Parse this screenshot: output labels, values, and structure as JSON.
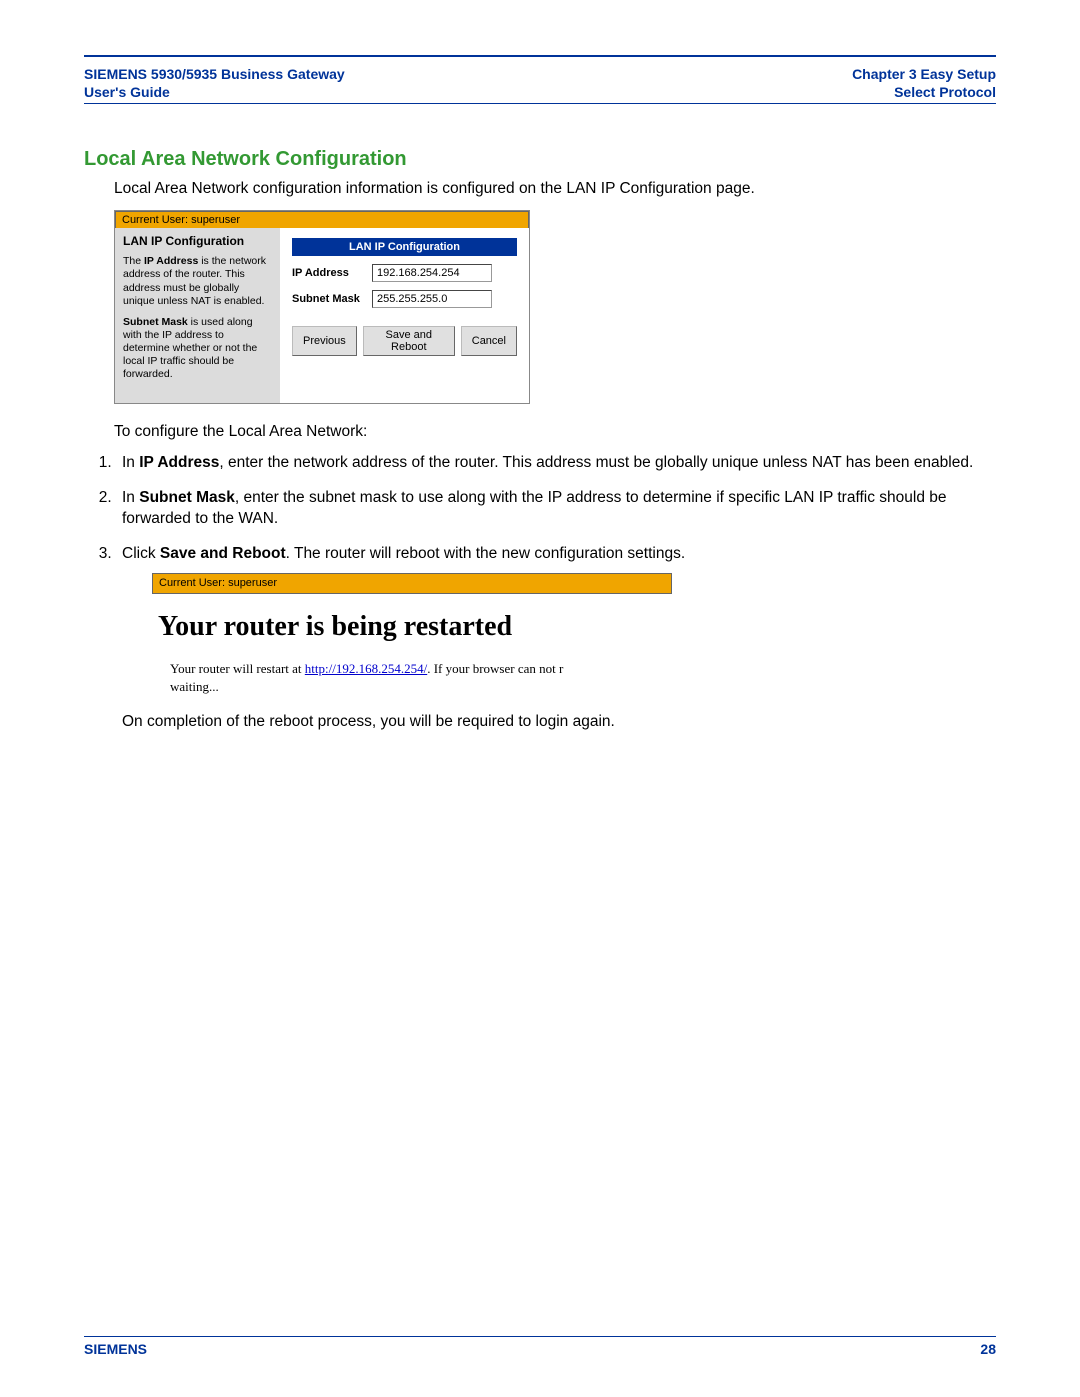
{
  "header": {
    "left_line1": "SIEMENS 5930/5935 Business Gateway",
    "left_line2": "User's Guide",
    "right_line1": "Chapter 3  Easy Setup",
    "right_line2": "Select Protocol"
  },
  "section_title": "Local Area Network Configuration",
  "intro_text": "Local Area Network configuration information is configured on the LAN IP Configuration page.",
  "shot1": {
    "current_user": "Current User: superuser",
    "panel_title": "LAN IP Configuration",
    "help_ip_prefix": "The ",
    "help_ip_bold": "IP Address",
    "help_ip_rest": " is the network address of the router. This address must be globally unique unless NAT is enabled.",
    "help_mask_bold": "Subnet Mask",
    "help_mask_rest": " is used along with the IP address to determine whether or not the local IP traffic should be forwarded.",
    "config_header": "LAN IP Configuration",
    "label_ip": "IP Address",
    "value_ip": "192.168.254.254",
    "label_mask": "Subnet Mask",
    "value_mask": "255.255.255.0",
    "btn_prev": "Previous",
    "btn_save": "Save and Reboot",
    "btn_cancel": "Cancel"
  },
  "configure_intro": "To configure the Local Area Network:",
  "steps": {
    "s1_pre": "In ",
    "s1_bold": "IP Address",
    "s1_post": ", enter the network address of the router. This address must be globally unique unless NAT has been enabled.",
    "s2_pre": "In ",
    "s2_bold": "Subnet Mask",
    "s2_post": ", enter the subnet mask to use along with the IP address to determine if specific LAN IP traffic should be forwarded to the WAN.",
    "s3_pre": "Click ",
    "s3_bold": "Save and Reboot",
    "s3_post": ". The router will reboot with the new configuration settings."
  },
  "shot2": {
    "current_user": "Current User: superuser",
    "heading": "Your router is being restarted",
    "msg_pre": "Your router will restart at ",
    "msg_link": "http://192.168.254.254/",
    "msg_post": ". If your browser can not r",
    "msg_line2": "waiting..."
  },
  "after_shot2": "On completion of the reboot process, you will be required to login again.",
  "footer": {
    "brand": "SIEMENS",
    "page": "28"
  }
}
